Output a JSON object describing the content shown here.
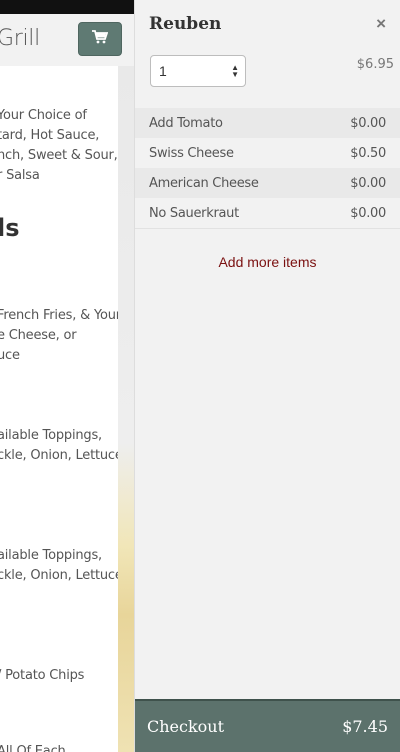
{
  "background": {
    "site_title": "Grill",
    "menu_lines": [
      "Your Choice of",
      "tard, Hot Sauce,",
      "nch, Sweet & Sour,",
      "r Salsa",
      "French Fries, & Your",
      "e Cheese, or",
      "uce",
      "ailable Toppings,",
      "ckle, Onion, Lettuce",
      "ailable Toppings,",
      "ckle, Onion, Lettuce",
      "/ Potato Chips",
      "All Of Each"
    ],
    "section_heading": "ls"
  },
  "panel": {
    "item_name": "Reuben",
    "close_symbol": "×",
    "quantity": "1",
    "base_price": "$6.95",
    "modifiers": [
      {
        "name": "Add Tomato",
        "price": "$0.00"
      },
      {
        "name": "Swiss Cheese",
        "price": "$0.50"
      },
      {
        "name": "American Cheese",
        "price": "$0.00"
      },
      {
        "name": "No Sauerkraut",
        "price": "$0.00"
      }
    ],
    "add_more_label": "Add more items",
    "checkout_label": "Checkout",
    "total": "$7.45"
  },
  "colors": {
    "accent_green": "#5c726c",
    "link_red": "#7a1010"
  },
  "icons": {
    "cart": "shopping-cart-icon",
    "close": "close-icon",
    "select_arrows": "select-arrows-icon"
  }
}
